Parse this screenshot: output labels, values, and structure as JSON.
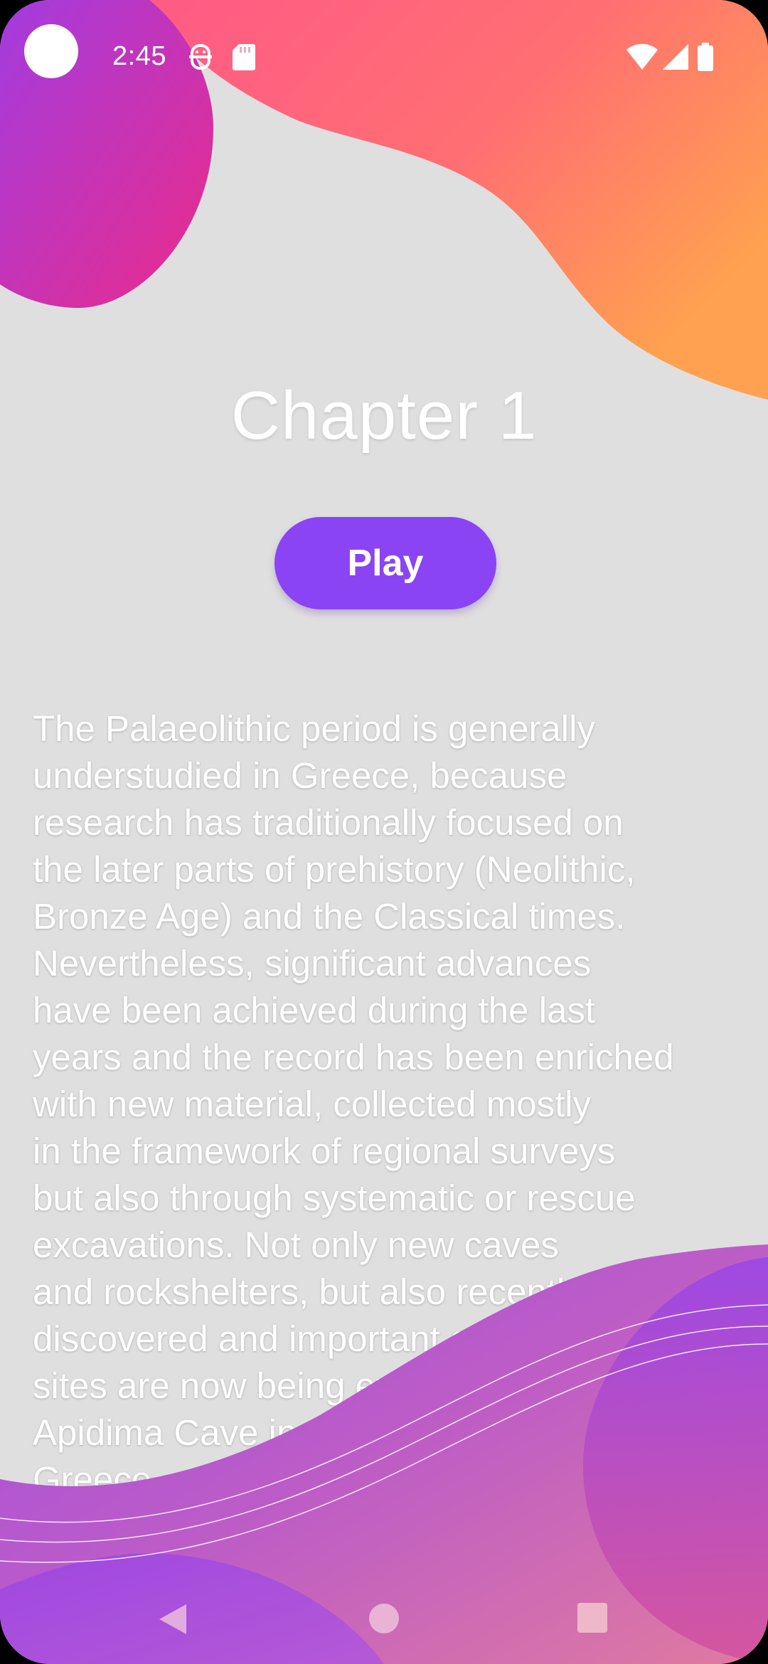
{
  "status_bar": {
    "time": "2:45",
    "icons": [
      "camera-cutout",
      "battery-saver-icon",
      "sd-card-icon",
      "wifi-icon",
      "signal-icon",
      "battery-icon"
    ]
  },
  "content": {
    "title": "Chapter 1",
    "play_label": "Play",
    "description": "The Palaeolithic period is generally\nunderstudied in Greece, because\nresearch has traditionally focused on\nthe later parts of prehistory (Neolithic,\nBronze Age) and the Classical times.\nNevertheless, significant advances\nhave been achieved during the last\nyears and the record has been enriched\nwith new material, collected mostly\nin the framework of regional surveys\nbut also through systematic or rescue\nexcavations. Not only new caves\nand rockshelters, but also recently\ndiscovered and important open-air\nsites are now being excavated, such as\nApidima Cave in the southern\nGreece"
  },
  "nav_bar": {
    "buttons": [
      "back-icon",
      "home-icon",
      "recents-icon"
    ]
  },
  "colors": {
    "background": "#e0dfdf",
    "accent": "#8a44f4",
    "blob_purple": "#9b45e8",
    "blob_pink": "#e22d8f",
    "blob_orange": "#ffa150"
  }
}
